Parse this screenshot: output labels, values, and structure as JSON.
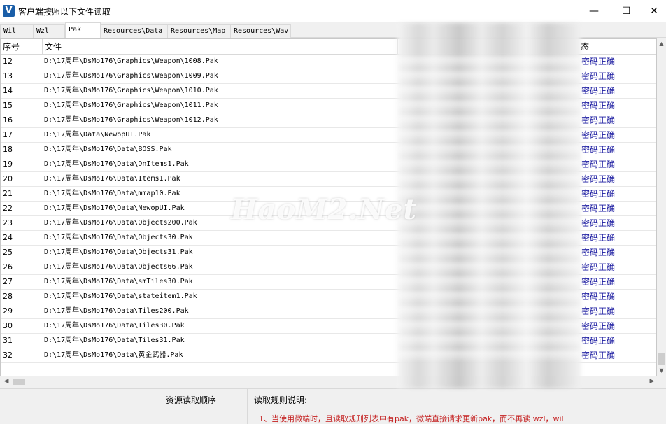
{
  "window": {
    "app_icon_glyph": "V",
    "title": "客户端按照以下文件读取",
    "minimize_glyph": "—",
    "maximize_glyph": "☐",
    "close_glyph": "✕"
  },
  "tabs": [
    {
      "label": "Wil"
    },
    {
      "label": "Wzl"
    },
    {
      "label": "Pak",
      "active": true
    },
    {
      "label": "Resources\\Data"
    },
    {
      "label": "Resources\\Map"
    },
    {
      "label": "Resources\\Wav"
    }
  ],
  "table": {
    "headers": {
      "num": "序号",
      "file": "文件",
      "status": "态"
    },
    "rows": [
      {
        "num": "12",
        "file": "D:\\17周年\\DsMo176\\Graphics\\Weapon\\1008.Pak",
        "status": "密码正确"
      },
      {
        "num": "13",
        "file": "D:\\17周年\\DsMo176\\Graphics\\Weapon\\1009.Pak",
        "status": "密码正确"
      },
      {
        "num": "14",
        "file": "D:\\17周年\\DsMo176\\Graphics\\Weapon\\1010.Pak",
        "status": "密码正确"
      },
      {
        "num": "15",
        "file": "D:\\17周年\\DsMo176\\Graphics\\Weapon\\1011.Pak",
        "status": "密码正确"
      },
      {
        "num": "16",
        "file": "D:\\17周年\\DsMo176\\Graphics\\Weapon\\1012.Pak",
        "status": "密码正确"
      },
      {
        "num": "17",
        "file": "D:\\17周年\\Data\\NewopUI.Pak",
        "status": "密码正确"
      },
      {
        "num": "18",
        "file": "D:\\17周年\\DsMo176\\Data\\BOSS.Pak",
        "status": "密码正确"
      },
      {
        "num": "19",
        "file": "D:\\17周年\\DsMo176\\Data\\DnItems1.Pak",
        "status": "密码正确"
      },
      {
        "num": "20",
        "file": "D:\\17周年\\DsMo176\\Data\\Items1.Pak",
        "status": "密码正确"
      },
      {
        "num": "21",
        "file": "D:\\17周年\\DsMo176\\Data\\mmap10.Pak",
        "status": "密码正确"
      },
      {
        "num": "22",
        "file": "D:\\17周年\\DsMo176\\Data\\NewopUI.Pak",
        "status": "密码正确"
      },
      {
        "num": "23",
        "file": "D:\\17周年\\DsMo176\\Data\\Objects200.Pak",
        "status": "密码正确"
      },
      {
        "num": "24",
        "file": "D:\\17周年\\DsMo176\\Data\\Objects30.Pak",
        "status": "密码正确"
      },
      {
        "num": "25",
        "file": "D:\\17周年\\DsMo176\\Data\\Objects31.Pak",
        "status": "密码正确"
      },
      {
        "num": "26",
        "file": "D:\\17周年\\DsMo176\\Data\\Objects66.Pak",
        "status": "密码正确"
      },
      {
        "num": "27",
        "file": "D:\\17周年\\DsMo176\\Data\\smTiles30.Pak",
        "status": "密码正确"
      },
      {
        "num": "28",
        "file": "D:\\17周年\\DsMo176\\Data\\stateitem1.Pak",
        "status": "密码正确"
      },
      {
        "num": "29",
        "file": "D:\\17周年\\DsMo176\\Data\\Tiles200.Pak",
        "status": "密码正确"
      },
      {
        "num": "30",
        "file": "D:\\17周年\\DsMo176\\Data\\Tiles30.Pak",
        "status": "密码正确"
      },
      {
        "num": "31",
        "file": "D:\\17周年\\DsMo176\\Data\\Tiles31.Pak",
        "status": "密码正确"
      },
      {
        "num": "32",
        "file": "D:\\17周年\\DsMo176\\Data\\黄金武器.Pak",
        "status": "密码正确"
      }
    ]
  },
  "watermark": "HaoM2.Net",
  "scroll": {
    "up_glyph": "▲",
    "down_glyph": "▼",
    "left_glyph": "◀",
    "right_glyph": "▶"
  },
  "bottom": {
    "left_title": "资源读取顺序",
    "right_title": "读取规则说明:",
    "rule_line": "1、当使用微端时，且读取规则列表中有pak，微端直接请求更新pak，而不再读 wzl，wil"
  },
  "colors": {
    "status_text": "#1a1aa0",
    "rule_text": "#c41f1f",
    "app_icon_bg": "#1a5ea8"
  }
}
